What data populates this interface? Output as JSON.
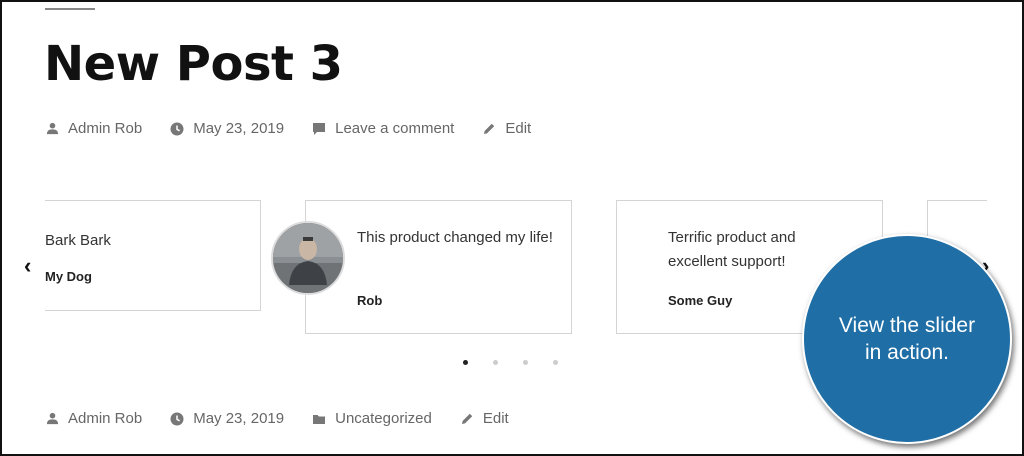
{
  "post": {
    "title": "New Post 3"
  },
  "meta_top": {
    "author": "Admin Rob",
    "date": "May 23, 2019",
    "comments": "Leave a comment",
    "edit": "Edit"
  },
  "slider": {
    "prev_arrow": "‹",
    "next_arrow": "›",
    "cards": [
      {
        "quote": "Bark Bark",
        "author": "My Dog"
      },
      {
        "quote": "This product changed my life!",
        "author": "Rob"
      },
      {
        "quote": "Terrific product and excellent support!",
        "author": "Some Guy"
      }
    ],
    "active_dot": 1,
    "dot_count": 4
  },
  "meta_bottom": {
    "author": "Admin Rob",
    "date": "May 23, 2019",
    "category": "Uncategorized",
    "edit": "Edit"
  },
  "callout": {
    "line1": "View the slider",
    "line2": "in action."
  },
  "colors": {
    "callout_bg": "#1f6ea6",
    "meta_text": "#666666",
    "card_border": "#d4d4d4"
  }
}
